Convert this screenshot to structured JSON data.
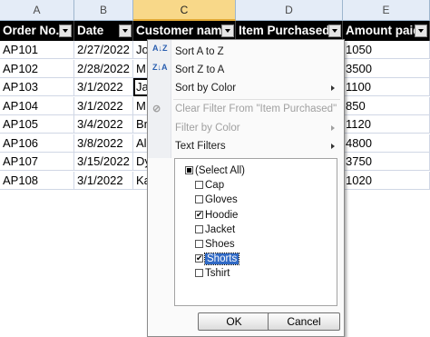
{
  "columns": [
    "A",
    "B",
    "C",
    "D",
    "E"
  ],
  "headers": [
    "Order No.",
    "Date",
    "Customer name",
    "Item Purchased",
    "Amount paid"
  ],
  "rows": [
    [
      "AP101",
      "2/27/2022",
      "Jo",
      "",
      "1050"
    ],
    [
      "AP102",
      "2/28/2022",
      "M",
      "",
      "3500"
    ],
    [
      "AP103",
      "3/1/2022",
      "Ja",
      "",
      "1100"
    ],
    [
      "AP104",
      "3/1/2022",
      "M",
      "",
      "850"
    ],
    [
      "AP105",
      "3/4/2022",
      "Br",
      "",
      "1120"
    ],
    [
      "AP106",
      "3/8/2022",
      "Al",
      "",
      "4800"
    ],
    [
      "AP107",
      "3/15/2022",
      "Dy",
      "",
      "3750"
    ],
    [
      "AP108",
      "3/1/2022",
      "Ka",
      "",
      "1020"
    ]
  ],
  "menu": {
    "sort_az": "Sort A to Z",
    "sort_za": "Sort Z to A",
    "sort_color": "Sort by Color",
    "clear_filter": "Clear Filter From \"Item Purchased\"",
    "filter_color": "Filter by Color",
    "text_filters": "Text Filters",
    "icon_az": "A↓Z",
    "icon_za": "Z↓A"
  },
  "filter_list": [
    {
      "label": "(Select All)",
      "state": "mixed"
    },
    {
      "label": "Cap",
      "state": "unchecked"
    },
    {
      "label": "Gloves",
      "state": "unchecked"
    },
    {
      "label": "Hoodie",
      "state": "checked"
    },
    {
      "label": "Jacket",
      "state": "unchecked"
    },
    {
      "label": "Shoes",
      "state": "unchecked"
    },
    {
      "label": "Shorts",
      "state": "checked",
      "highlighted": true
    },
    {
      "label": "Tshirt",
      "state": "unchecked"
    }
  ],
  "buttons": {
    "ok": "OK",
    "cancel": "Cancel"
  },
  "colors": {
    "header_bg": "#000000",
    "selected_col": "#f8d889",
    "highlight": "#316ac5"
  }
}
